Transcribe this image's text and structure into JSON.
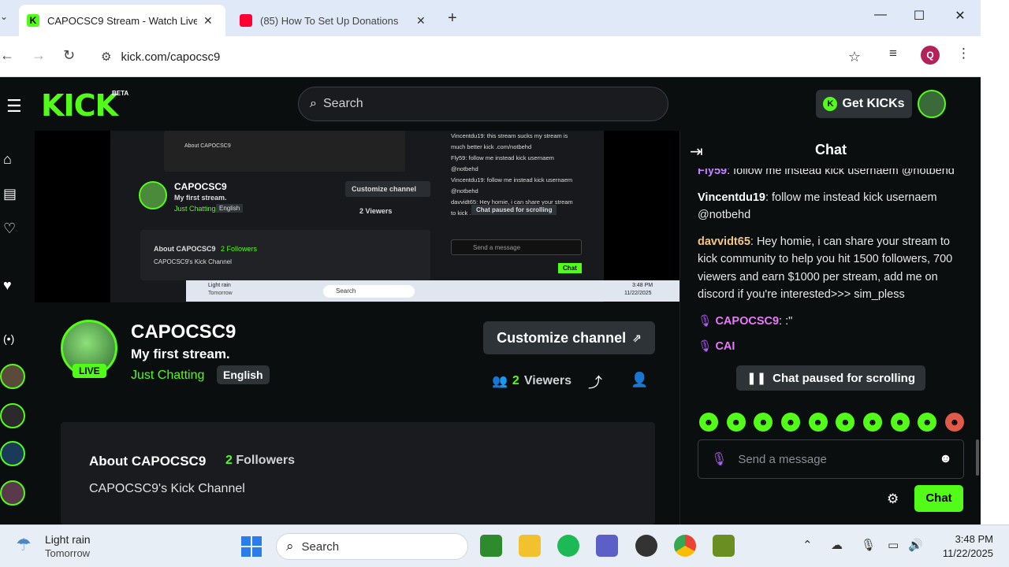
{
  "browser": {
    "tabs": [
      {
        "title": "CAPOCSC9 Stream - Watch Live",
        "favicon": "kick-icon",
        "active": true
      },
      {
        "title": "(85) How To Set Up Donations",
        "favicon": "youtube-icon",
        "active": false
      }
    ],
    "new_tab": "+",
    "url": "kick.com/capocsc9",
    "profile_initial": "Q"
  },
  "kick": {
    "logo": "KICK",
    "beta": "BETA",
    "search_placeholder": "Search",
    "get_kicks": "Get KICKs",
    "player": {
      "mini_channel": "CAPOCSC9",
      "mini_title": "My first stream.",
      "mini_category": "Just Chatting",
      "mini_lang": "English",
      "mini_customize": "Customize channel",
      "mini_viewers": "2 Viewers",
      "mini_about": "About CAPOCSC9",
      "mini_followers": "2 Followers",
      "mini_desc": "CAPOCSC9's Kick Channel",
      "mini_pause": "Chat paused for scrolling",
      "mini_send": "Send a message",
      "mini_chat": "Chat",
      "mini_chat_lines": [
        "Vincentdu19: this stream sucks my stream is",
        "much better kick .com/notbehd",
        "Fly59: follow me instead kick usernaem",
        "@notbehd",
        "Vincentdu19: follow me instead kick usernaem",
        "@notbehd",
        "davvidt65: Hey homie, i can share your stream",
        "to kick ... follow..."
      ],
      "mini_weather": "Light rain",
      "mini_weather2": "Tomorrow",
      "mini_search": "Search",
      "mini_time": "3:48 PM",
      "mini_date": "11/22/2025"
    },
    "channel": {
      "name": "CAPOCSC9",
      "live": "LIVE",
      "title": "My first stream.",
      "category": "Just Chatting",
      "language": "English",
      "customize": "Customize channel",
      "viewers_count": "2",
      "viewers_label": "Viewers",
      "about_title": "About CAPOCSC9",
      "followers_count": "2",
      "followers_label": "Followers",
      "about_desc": "CAPOCSC9's Kick Channel"
    },
    "chat": {
      "title": "Chat",
      "messages": [
        {
          "user": "Fly59",
          "color": "#c084fc",
          "text": ": follow me instead kick usernaem @notbehd"
        },
        {
          "user": "Vincentdu19",
          "color": "#ffffff",
          "text": ": follow me instead kick usernaem @notbehd"
        },
        {
          "user": "davvidt65",
          "color": "#f5c77e",
          "text": ": Hey homie, i can share your stream to kick community to help you hit 1500 followers, 700 viewers and earn $1000 per stream, add me on discord if you're interested>>> sim_pless"
        },
        {
          "user": "CAPOCSC9",
          "color": "#e879f9",
          "text": ": :\""
        },
        {
          "user": "CAI",
          "color": "#e879f9",
          "text": ""
        }
      ],
      "paused": "Chat paused for scrolling",
      "placeholder": "Send a message",
      "send": "Chat"
    }
  },
  "taskbar": {
    "weather": "Light rain",
    "weather_sub": "Tomorrow",
    "search": "Search",
    "time": "3:48 PM",
    "date": "11/22/2025"
  },
  "colors": {
    "accent": "#53fc18",
    "bg": "#0b0e0f",
    "panel": "#191b1f"
  }
}
